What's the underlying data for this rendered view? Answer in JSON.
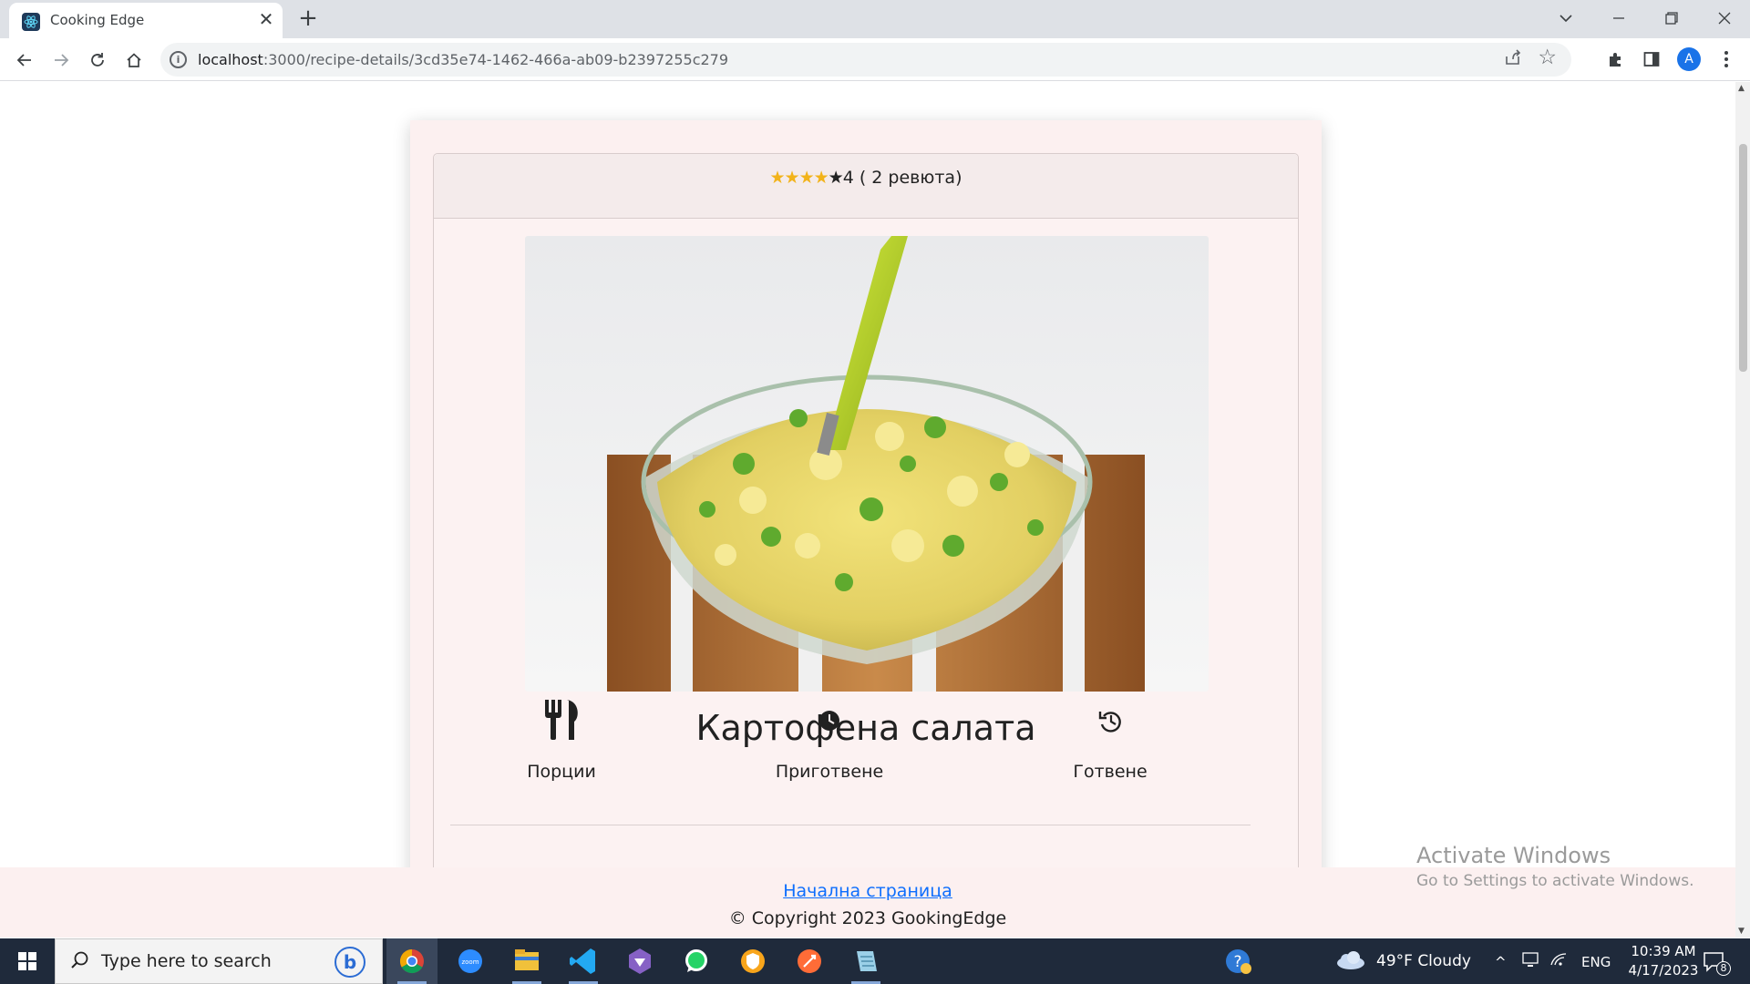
{
  "browser": {
    "tab_title": "Cooking Edge",
    "tab_close": "✕",
    "new_tab": "+",
    "url_host": "localhost",
    "url_path": ":3000/recipe-details/3cd35e74-1462-466a-ab09-b2397255c279",
    "avatar_letter": "A"
  },
  "recipe": {
    "rating_stars": "★★★★",
    "rating_last_star": "★",
    "rating_text": "4 ( 2 ревюта)",
    "rating_value": 4,
    "title": "Картофена салата",
    "info": [
      {
        "label": "Порции",
        "icon": "utensils-icon"
      },
      {
        "label": "Приготвене",
        "icon": "clock-icon"
      },
      {
        "label": "Готвене",
        "icon": "history-icon"
      }
    ]
  },
  "footer": {
    "link": "Начална страница",
    "copyright": "© Copyright 2023 GookingEdge"
  },
  "watermark": {
    "line1": "Activate Windows",
    "line2": "Go to Settings to activate Windows."
  },
  "taskbar": {
    "search_placeholder": "Type here to search",
    "weather": "49°F  Cloudy",
    "language": "ENG",
    "time": "10:39 AM",
    "date": "4/17/2023",
    "notification_count": "8"
  },
  "colors": {
    "accent_star": "#f2b31a",
    "link": "#0d6efd",
    "card_bg": "#fcf2f2",
    "taskbar": "#1f2a3b"
  }
}
